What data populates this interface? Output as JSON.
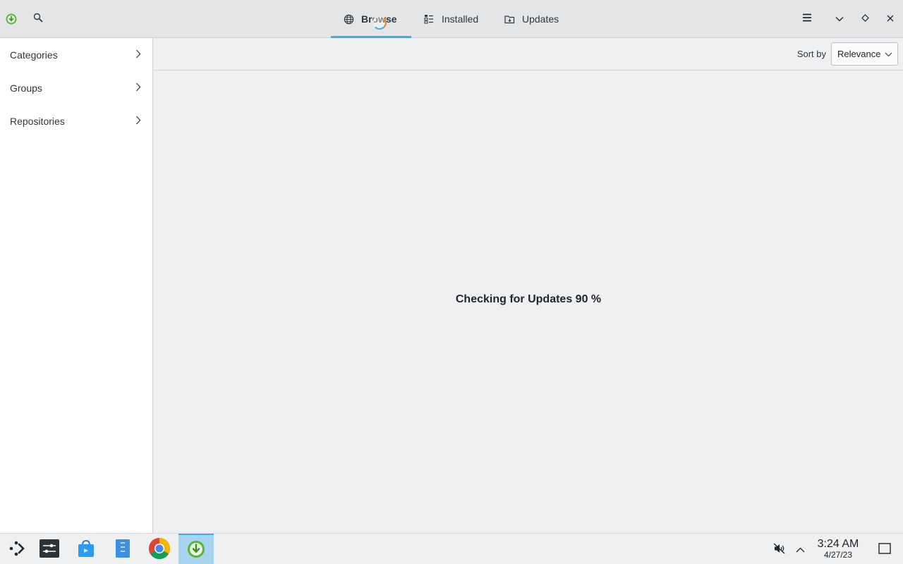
{
  "header": {
    "app_icon": "discover-icon",
    "search_icon": "search-icon",
    "tabs": [
      {
        "label": "Browse",
        "icon": "globe-icon",
        "active": true
      },
      {
        "label": "Installed",
        "icon": "installed-list-icon",
        "active": false
      },
      {
        "label": "Updates",
        "icon": "updates-folder-icon",
        "active": false
      }
    ],
    "window_controls": [
      "hamburger-menu-icon",
      "minimize-icon",
      "maximize-icon",
      "close-icon"
    ]
  },
  "sidebar": {
    "items": [
      {
        "label": "Categories"
      },
      {
        "label": "Groups"
      },
      {
        "label": "Repositories"
      }
    ]
  },
  "main": {
    "sort_label": "Sort by",
    "sort_value": "Relevance",
    "status": "Checking for Updates 90 %"
  },
  "taskbar": {
    "apps": [
      "application-launcher-icon",
      "system-settings-icon",
      "store-icon",
      "file-manager-icon",
      "chrome-icon",
      "discover-icon"
    ],
    "active_app": "discover-icon",
    "tray": [
      "muted-volume-icon",
      "expand-tray-icon"
    ],
    "time": "3:24 AM",
    "date": "4/27/23",
    "show_desktop_icon": "show-desktop-icon"
  },
  "colors": {
    "accent": "#3daee9",
    "header_bg": "#e3e5e7",
    "sidebar_bg": "#ffffff",
    "main_bg": "#eff0f1",
    "discover_green": "#5bb534"
  }
}
